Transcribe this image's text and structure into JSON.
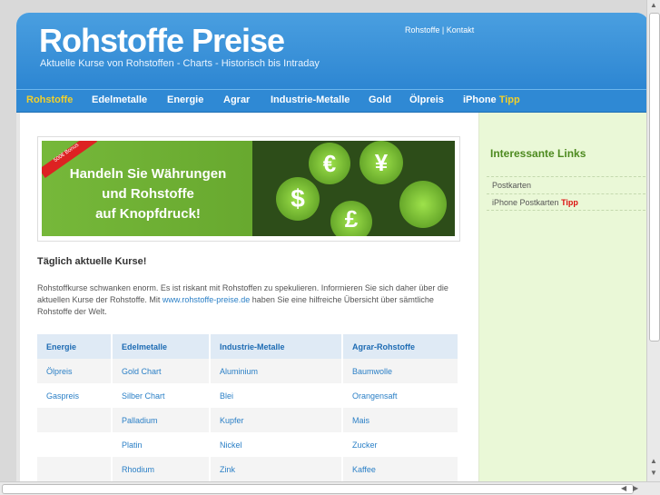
{
  "header": {
    "title": "Rohstoffe Preise",
    "tagline": "Aktuelle Kurse von Rohstoffen - Charts - Historisch bis Intraday",
    "toplinks": [
      "Rohstoffe",
      "|",
      "Kontakt"
    ]
  },
  "nav": [
    {
      "label": "Rohstoffe",
      "active": true
    },
    {
      "label": "Edelmetalle"
    },
    {
      "label": "Energie"
    },
    {
      "label": "Agrar"
    },
    {
      "label": "Industrie-Metalle"
    },
    {
      "label": "Gold"
    },
    {
      "label": "Ölpreis"
    },
    {
      "label": "iPhone",
      "suffix": "Tipp"
    }
  ],
  "banner": {
    "badge": "500€ Bonus",
    "line1": "Handeln Sie Währungen",
    "line2": "und Rohstoffe",
    "line3": "auf Knopfdruck!",
    "symbols": [
      "€",
      "¥",
      "$",
      "£"
    ]
  },
  "main": {
    "title": "Täglich aktuelle Kurse!",
    "intro_1": "Rohstoffkurse schwanken enorm. Es ist riskant mit Rohstoffen zu spekulieren. Informieren Sie sich daher über die aktuellen Kurse der Rohstoffe. Mit ",
    "intro_link": "www.rohstoffe-preise.de",
    "intro_2": " haben Sie eine hilfreiche Übersicht über sämtliche Rohstoffe der Welt.",
    "table": {
      "headers": [
        "Energie",
        "Edelmetalle",
        "Industrie-Metalle",
        "Agrar-Rohstoffe"
      ],
      "rows": [
        [
          "Ölpreis",
          "Gold Chart",
          "Aluminium",
          "Baumwolle"
        ],
        [
          "Gaspreis",
          "Silber Chart",
          "Blei",
          "Orangensaft"
        ],
        [
          "",
          "Palladium",
          "Kupfer",
          "Mais"
        ],
        [
          "",
          "Platin",
          "Nickel",
          "Zucker"
        ],
        [
          "",
          "Rhodium",
          "Zink",
          "Kaffee"
        ]
      ]
    }
  },
  "sidebar": {
    "title": "Interessante Links",
    "links": [
      {
        "label": "Postkarten"
      },
      {
        "label": "iPhone Postkarten",
        "suffix": "Tipp"
      }
    ]
  },
  "colors": {
    "header_blue": "#2d86d2",
    "nav_active": "#f3d02a",
    "link_blue": "#2a7fc6",
    "sidebar_green": "#eaf8d7",
    "sidebar_title": "#4d8a1f",
    "tipp_red": "#d11111"
  }
}
